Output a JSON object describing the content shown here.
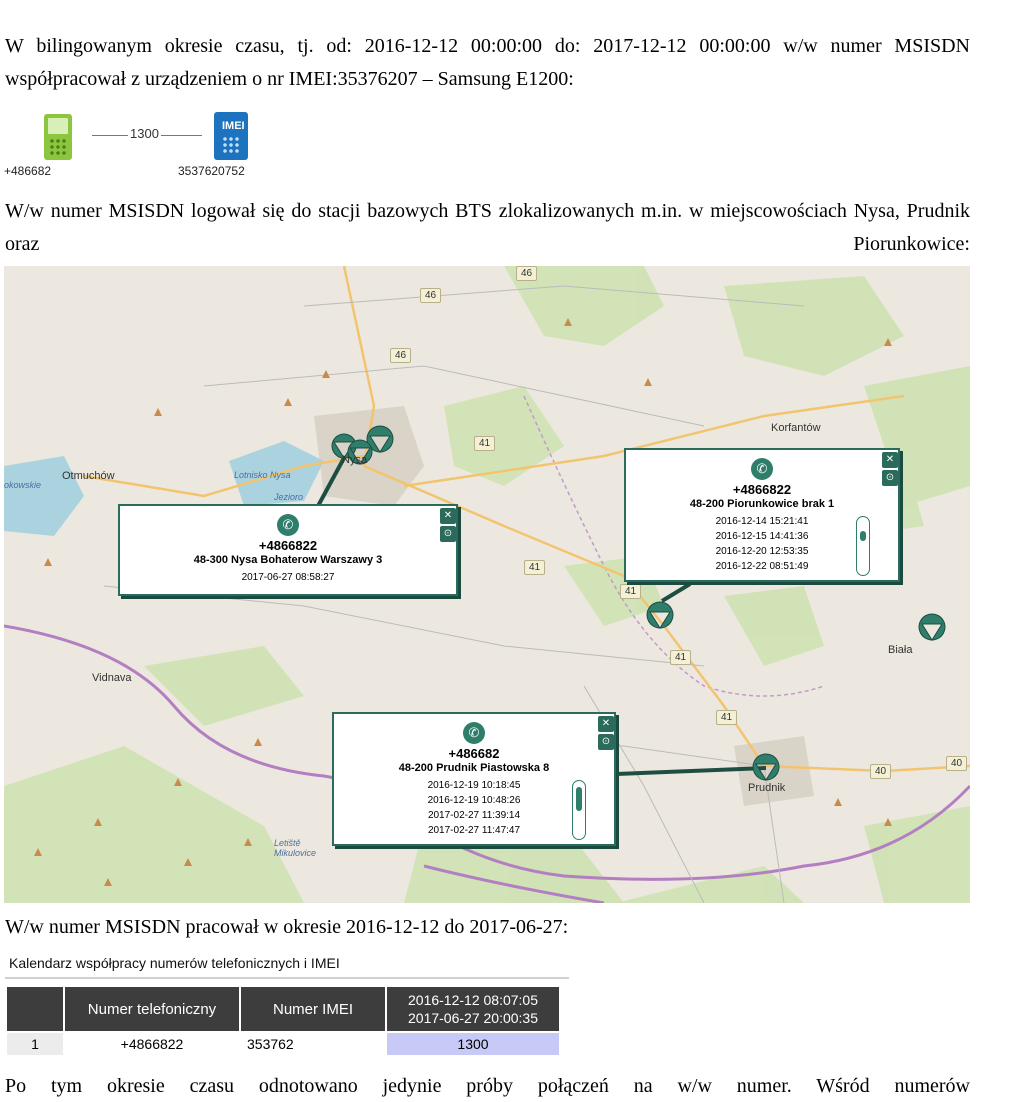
{
  "paragraph1": "W bilingowanym okresie czasu, tj. od: 2016-12-12 00:00:00 do: 2017-12-12 00:00:00 w/w numer MSISDN współpracował z urządzeniem o nr IMEI:35376207 – Samsung E1200:",
  "link": {
    "phone_caption": "+486682",
    "imei_caption": "3537620752",
    "duration": "1300",
    "imei_badge": "IMEI",
    "colors": {
      "phone": "#8cc63f",
      "imei": "#1e73be"
    }
  },
  "paragraph2": "W/w numer MSISDN logował się do stacji bazowych BTS zlokalizowanych m.in. w miejscowościach Nysa, Prudnik oraz Piorunkowice:",
  "map": {
    "towns": [
      "Nysa",
      "Otmuchów",
      "Korfantów",
      "Vidnava",
      "Biała",
      "Prudnik",
      "Lotnisko Nysa",
      "Jezioro",
      "Letiště Mikulovice",
      "okowskie"
    ],
    "roads": [
      "46",
      "46",
      "41",
      "41",
      "41",
      "41",
      "41",
      "40",
      "40",
      "46"
    ],
    "popups": [
      {
        "number": "+4866822",
        "address": "48-300 Nysa Bohaterow Warszawy 3",
        "times": [
          "2017-06-27 08:58:27"
        ]
      },
      {
        "number": "+4866822",
        "address": "48-200 Piorunkowice brak 1",
        "times": [
          "2016-12-14 15:21:41",
          "2016-12-15 14:41:36",
          "2016-12-20 12:53:35",
          "2016-12-22 08:51:49"
        ]
      },
      {
        "number": "+486682",
        "address": "48-200 Prudnik Piastowska 8",
        "times": [
          "2016-12-19 10:18:45",
          "2016-12-19 10:48:26",
          "2017-02-27 11:39:14",
          "2017-02-27 11:47:47"
        ]
      }
    ],
    "colors": {
      "marker": "#2f7d6b",
      "popup_border": "#2b6b5c"
    }
  },
  "paragraph3": "W/w numer MSISDN pracował w okresie 2016-12-12 do 2017-06-27:",
  "calendar": {
    "title": "Kalendarz współpracy numerów telefonicznych i IMEI",
    "headers": [
      "",
      "Numer telefoniczny",
      "Numer IMEI"
    ],
    "date_header": [
      "2016-12-12 08:07:05",
      "2017-06-27 20:00:35"
    ],
    "rows": [
      {
        "index": "1",
        "phone": "+4866822",
        "imei": "353762",
        "value": "1300"
      }
    ],
    "colors": {
      "header": "#3d3d3d",
      "value_cell": "#c7c9f7"
    }
  },
  "paragraph4": "Po tym okresie czasu odnotowano jedynie próby połączeń na w/w numer. Wśród numerów"
}
